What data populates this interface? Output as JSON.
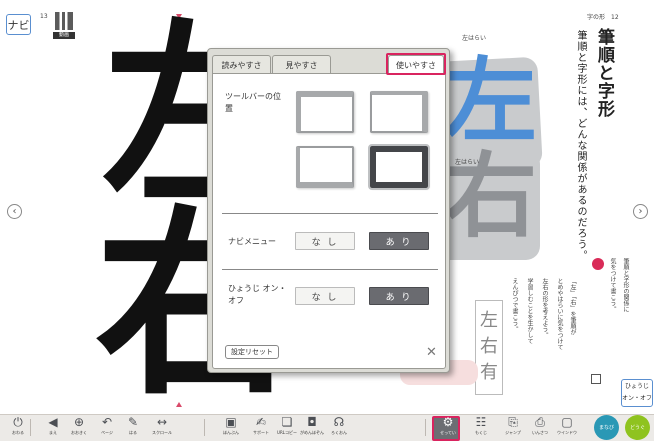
{
  "page": {
    "navi_label": "ナビ",
    "qr_label": "動画",
    "page_left": "13",
    "page_right_section": "字の形",
    "page_right": "12",
    "big_chars": [
      "左",
      "右"
    ],
    "sample_chars": [
      "左",
      "右"
    ],
    "hidari_label": "左はらい",
    "title": "筆順と字形",
    "subtitle": "筆順と字形には、どんな関係があるのだろう。",
    "guide_columns": [
      "筆順と字形の関係に",
      "気をつけて書こう。",
      "学習しむことを生かして",
      "えんぴつで書こう。",
      "「左」「右」を筆順が",
      "とめやはらいに気をつけて",
      "左右の形を考えよう。"
    ],
    "mini_chars": [
      "左",
      "右",
      "有"
    ],
    "hyoji_label": [
      "ひょうじ",
      "オン・オフ"
    ]
  },
  "dialog": {
    "tabs": [
      "読みやすさ",
      "見やすさ",
      "使いやすさ"
    ],
    "toolbar_position_label": "ツールバーの位置",
    "navi_menu_label": "ナビメニュー",
    "hyoji_label": "ひょうじ オン・オフ",
    "option_off": "な し",
    "option_on": "あ り",
    "reset_label": "設定リセット",
    "close_glyph": "✕"
  },
  "toolbar": {
    "items": [
      {
        "icon": "power-icon",
        "glyph": "⏻",
        "label": "おわる"
      },
      {
        "icon": "previous-page-icon",
        "glyph": "◀",
        "label": "まえ"
      },
      {
        "icon": "zoom-in-icon",
        "glyph": "⊕",
        "label": "おおきく"
      },
      {
        "icon": "undo-icon",
        "glyph": "↶",
        "label": "ページ"
      },
      {
        "icon": "paste-icon",
        "glyph": "✎",
        "label": "はる"
      },
      {
        "icon": "scroll-icon",
        "glyph": "↔",
        "label": "スクロール"
      },
      {
        "icon": "text-zoom-icon",
        "glyph": "▣",
        "label": "ほんぶん"
      },
      {
        "icon": "support-icon",
        "glyph": "✍",
        "label": "サポート"
      },
      {
        "icon": "ur-copy-icon",
        "glyph": "❏",
        "label": "URLコピー"
      },
      {
        "icon": "camera-icon",
        "glyph": "◘",
        "label": "がめんほぞん"
      },
      {
        "icon": "microphone-icon",
        "glyph": "☊",
        "label": "ろくおん"
      },
      {
        "icon": "settings-icon",
        "glyph": "⚙",
        "label": "せってい"
      },
      {
        "icon": "contents-icon",
        "glyph": "☷",
        "label": "もくじ"
      },
      {
        "icon": "jump-icon",
        "glyph": "⎘",
        "label": "ジャンプ"
      },
      {
        "icon": "print-icon",
        "glyph": "⎙",
        "label": "いんさつ"
      },
      {
        "icon": "window-icon",
        "glyph": "▢",
        "label": "ウインドウ"
      }
    ],
    "round_buttons": [
      "まなび",
      "どうぐ"
    ]
  }
}
